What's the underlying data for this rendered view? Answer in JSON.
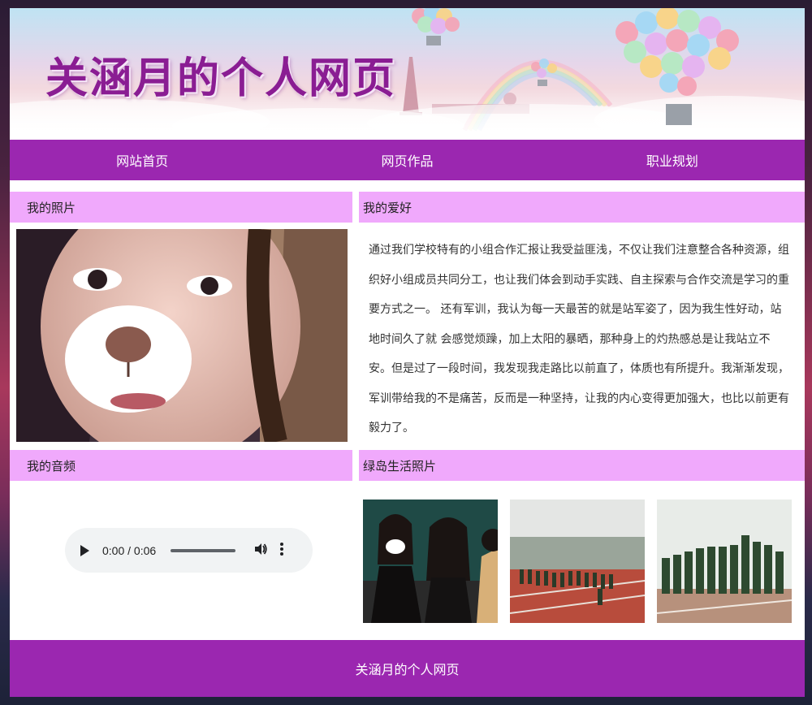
{
  "banner": {
    "title": "关涵月的个人网页"
  },
  "nav": {
    "items": [
      {
        "label": "网站首页"
      },
      {
        "label": "网页作品"
      },
      {
        "label": "职业规划"
      }
    ]
  },
  "sections": {
    "photo": {
      "title": "我的照片"
    },
    "hobby": {
      "title": "我的爱好",
      "text": "通过我们学校特有的小组合作汇报让我受益匪浅，不仅让我们注意整合各种资源，组织好小组成员共同分工，也让我们体会到动手实践、自主探索与合作交流是学习的重要方式之一。 还有军训，我认为每一天最苦的就是站军姿了，因为我生性好动，站地时间久了就 会感觉烦躁，加上太阳的暴晒，那种身上的灼热感总是让我站立不安。但是过了一段时间，我发现我走路比以前直了，体质也有所提升。我渐渐发现，军训带给我的不是痛苦，反而是一种坚持，让我的内心变得更加强大，也比以前更有毅力了。"
    },
    "audio": {
      "title": "我的音频",
      "time": "0:00 / 0:06",
      "progress": 0
    },
    "gallery": {
      "title": "绿岛生活照片"
    }
  },
  "footer": {
    "text": "关涵月的个人网页"
  },
  "colors": {
    "accent": "#9b27b0",
    "section_bg": "#f0a9fc"
  }
}
